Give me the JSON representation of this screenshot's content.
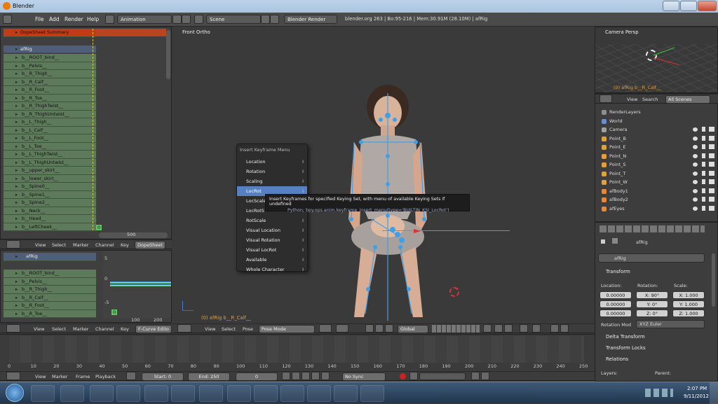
{
  "window": {
    "title": "Blender"
  },
  "topbar": {
    "menus": [
      "File",
      "Add",
      "Render",
      "Help"
    ],
    "layout": "Animation",
    "scene": "Scene",
    "engine": "Blender Render",
    "info": "blender.org 263 | Bo:95-216 | Mem:30.91M (28.10M) | afRig"
  },
  "dopesheet": {
    "summary": "DopeSheet Summary",
    "object": "afRig",
    "action": "a_pose4comp_pepper01",
    "channels": [
      "b__ROOT_bind__",
      "b__Pelvis__",
      "b__R_Thigh__",
      "b__R_Calf__",
      "b__R_Foot__",
      "b__R_Toe__",
      "b__R_ThighTwist__",
      "b__R_ThighUntwist__",
      "b__L_Thigh__",
      "b__L_Calf__",
      "b__L_Foot__",
      "b__L_Toe__",
      "b__L_ThighTwist__",
      "b__L_ThighUntwist__",
      "b__upper_skirt__",
      "b__lower_skirt__",
      "b__Spine0__",
      "b__Spine1__",
      "b__Spine2__",
      "b__Neck__",
      "b__Head__",
      "b__LeftCheek__"
    ],
    "frame_badge": "0",
    "scroll_value": "500",
    "header": {
      "view": "View",
      "select": "Select",
      "marker": "Marker",
      "channel": "Channel",
      "key": "Key",
      "mode": "DopeSheet"
    }
  },
  "fcurve": {
    "object": "afRig",
    "action": "a_pose4comp_pepper01",
    "channels": [
      "b__ROOT_bind__",
      "b__Pelvis__",
      "b__R_Thigh__",
      "b__R_Calf__",
      "b__R_Foot__",
      "b__R_Toe__"
    ],
    "yticks": [
      "5",
      "0",
      "-5"
    ],
    "ruler": [
      "100",
      "200"
    ],
    "frame_badge": "0",
    "header": {
      "view": "View",
      "select": "Select",
      "marker": "Marker",
      "channel": "Channel",
      "key": "Key",
      "mode": "F-Curve Edito"
    }
  },
  "viewport": {
    "label": "Front Ortho",
    "status": "(0) afRig b__R_Calf__",
    "header": {
      "view": "View",
      "select": "Select",
      "pose": "Pose",
      "mode": "Pose Mode",
      "orientation": "Global"
    }
  },
  "insert_menu": {
    "title": "Insert Keyframe Menu",
    "items": [
      "Location",
      "Rotation",
      "Scaling",
      "LocRot",
      "LocScale",
      "LocRotScale",
      "RotScale",
      "Visual Location",
      "Visual Rotation",
      "Visual LocRot",
      "Available",
      "Whole Character"
    ],
    "items_display": [
      "Location",
      "Rotation",
      "Scaling",
      "LocRot",
      "LocScale",
      "LocRotS",
      "RotScale",
      "Visual Location",
      "Visual Rotation",
      "Visual LocRot",
      "Available",
      "Whole Character"
    ],
    "selected": "LocRot"
  },
  "tooltip": {
    "text": "Insert Keyframes for specified Keying Set, with menu of available Keying Sets if undefined",
    "python": "Python: bpy.ops.anim.keyframe_insert_menu(type='BUILTIN_KSI_LocRot')"
  },
  "camview": {
    "label": "Camera Persp",
    "status": "(0) afRig b__R_Calf__"
  },
  "outliner": {
    "header": {
      "view": "View",
      "search": "Search",
      "filter": "All Scenes"
    },
    "rows": [
      "RenderLayers",
      "World",
      "Camera",
      "Point_B",
      "Point_E",
      "Point_N",
      "Point_S",
      "Point_T",
      "Point_W",
      "afBody1",
      "afBody2",
      "afEyes"
    ]
  },
  "properties": {
    "crumb": "afRig",
    "name": "afRig",
    "transform": "Transform",
    "location_label": "Location:",
    "rotation_label": "Rotation:",
    "scale_label": "Scale:",
    "location": [
      "0.00000",
      "0.00000",
      "0.00000"
    ],
    "rotation": [
      "X: 90°",
      "Y: 0°",
      "Z: 0°"
    ],
    "scale": [
      "X: 1.000",
      "Y: 1.000",
      "Z: 1.000"
    ],
    "rotation_mode_label": "Rotation Mod",
    "rotation_mode": "XYZ Euler",
    "delta": "Delta Transform",
    "locks": "Transform Locks",
    "relations": "Relations",
    "layers": "Layers:",
    "parent": "Parent:"
  },
  "timeline": {
    "ticks": [
      "0",
      "10",
      "20",
      "30",
      "40",
      "50",
      "60",
      "70",
      "80",
      "90",
      "100",
      "110",
      "120",
      "130",
      "140",
      "150",
      "160",
      "170",
      "180",
      "190",
      "200",
      "210",
      "220",
      "230",
      "240",
      "250"
    ],
    "header": {
      "view": "View",
      "marker": "Marker",
      "frame": "Frame",
      "playback": "Playback",
      "start": "Start: 0",
      "end": "End: 250",
      "current": "0",
      "sync": "No Sync"
    }
  },
  "taskbar": {
    "time": "2:07 PM",
    "date": "9/11/2012"
  },
  "colors": {
    "selected": "#5680c2",
    "summary": "#c23b16",
    "channel": "#5d7a5a",
    "bone": "#3fa0e8"
  }
}
